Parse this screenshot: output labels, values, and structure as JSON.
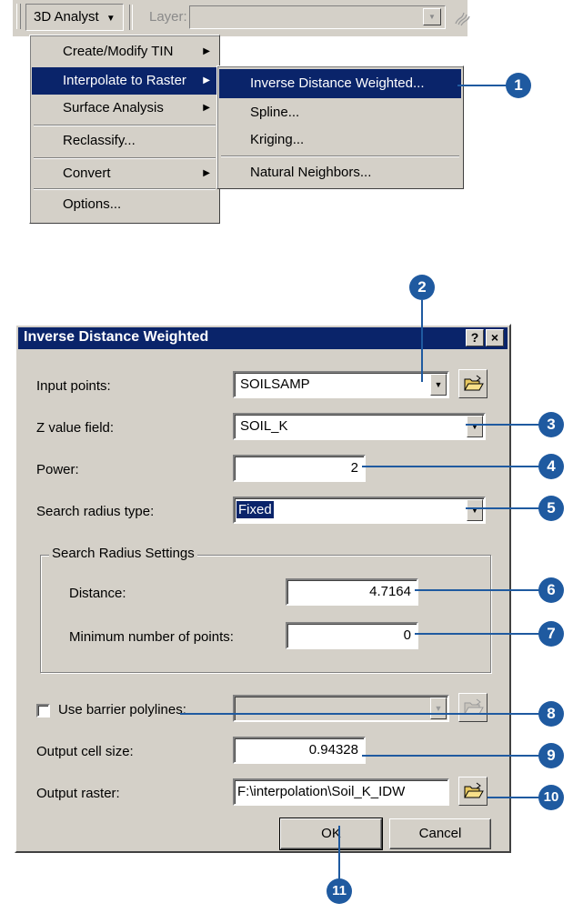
{
  "toolbar": {
    "menu_label": "3D Analyst",
    "layer_label": "Layer:"
  },
  "main_menu": {
    "items": [
      {
        "label": "Create/Modify TIN"
      },
      {
        "label": "Interpolate to Raster"
      },
      {
        "label": "Surface Analysis"
      },
      {
        "label": "Reclassify..."
      },
      {
        "label": "Convert"
      },
      {
        "label": "Options..."
      }
    ]
  },
  "sub_menu": {
    "items": [
      {
        "label": "Inverse Distance Weighted..."
      },
      {
        "label": "Spline..."
      },
      {
        "label": "Kriging..."
      },
      {
        "label": "Natural Neighbors..."
      }
    ]
  },
  "dialog": {
    "title": "Inverse Distance Weighted",
    "help_label": "?",
    "close_label": "×",
    "input_points_label": "Input points:",
    "input_points_value": "SOILSAMP",
    "z_field_label": "Z value field:",
    "z_field_value": "SOIL_K",
    "power_label": "Power:",
    "power_value": "2",
    "search_type_label": "Search radius type:",
    "search_type_value": "Fixed",
    "group_title": "Search Radius Settings",
    "distance_label": "Distance:",
    "distance_value": "4.7164",
    "min_points_label": "Minimum number of points:",
    "min_points_value": "0",
    "barrier_label": "Use barrier polylines:",
    "cell_size_label": "Output cell size:",
    "cell_size_value": "0.94328",
    "output_raster_label": "Output raster:",
    "output_raster_value": "F:\\interpolation\\Soil_K_IDW",
    "ok_label": "OK",
    "cancel_label": "Cancel"
  },
  "callouts": [
    "1",
    "2",
    "3",
    "4",
    "5",
    "6",
    "7",
    "8",
    "9",
    "10",
    "11"
  ],
  "colors": {
    "callout": "#1f5aa0",
    "highlight": "#0a246a",
    "face": "#d4d0c8"
  }
}
